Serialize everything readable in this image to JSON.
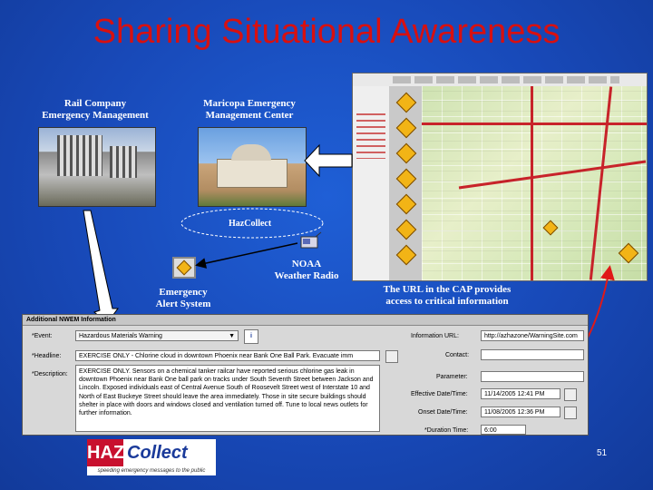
{
  "title": "Sharing Situational Awareness",
  "rail": {
    "label_line1": "Rail Company",
    "label_line2": "Emergency Management"
  },
  "maricopa": {
    "label_line1": "Maricopa Emergency",
    "label_line2": "Management Center"
  },
  "hazcollect_label": "HazCollect",
  "noaa": {
    "label_line1": "NOAA",
    "label_line2": "Weather Radio"
  },
  "eas": {
    "label_line1": "Emergency",
    "label_line2": "Alert System"
  },
  "cap_note": {
    "line1": "The URL in the CAP provides",
    "line2": "access to critical information"
  },
  "form": {
    "header": "Additional NWEM Information",
    "event_label": "*Event:",
    "event_value": "Hazardous Materials Warning",
    "headline_label": "*Headline:",
    "headline_value": "EXERCISE ONLY - Chlorine cloud in downtown Phoenix near Bank One Ball Park. Evacuate imm",
    "description_label": "*Description:",
    "description_value": "EXERCISE ONLY. Sensors on a chemical tanker railcar have reported serious chlorine gas leak in downtown Phoenix near Bank One ball park on tracks under South Seventh Street between Jackson and Lincoln. Exposed individuals east of Central Avenue South of Roosevelt Street west of Interstate 10 and North of East Buckeye Street should leave the area immediately. Those in site secure buildings should shelter in place with doors and windows closed and ventilation turned off. Tune to local news outlets for further information.",
    "info_url_label": "Information URL:",
    "info_url_value": "http://azhazone/WarningSite.com",
    "contact_label": "Contact:",
    "parameter_label": "Parameter:",
    "effective_label": "Effective Date/Time:",
    "effective_value": "11/14/2005 12:41 PM",
    "onset_label": "Onset Date/Time:",
    "onset_value": "11/08/2005 12:36 PM",
    "duration_label": "*Duration Time:",
    "duration_value": "6:00"
  },
  "logo": {
    "haz": "HAZ",
    "collect": "Collect",
    "tagline": "speeding emergency messages to the public"
  },
  "slide_number": "51",
  "colors": {
    "title": "#d81010",
    "background": "#1849b8",
    "arrow_red": "#e01818"
  }
}
